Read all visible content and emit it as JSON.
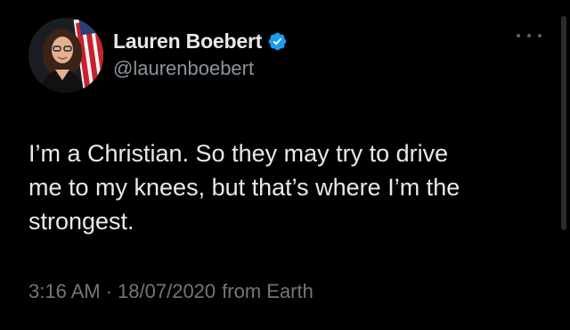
{
  "author": {
    "display_name": "Lauren Boebert",
    "handle": "@laurenboebert",
    "verified_icon": "verified-badge-icon",
    "avatar_icon": "profile-photo"
  },
  "more_menu_icon": "more-options-icon",
  "tweet": {
    "text": "I’m a Christian. So they may try to drive\nme to my knees, but that’s where I’m the\nstrongest.",
    "time": "3:16 AM",
    "separator": "·",
    "date": "18/07/2020",
    "source": "from Earth"
  },
  "colors": {
    "background": "#000000",
    "primary_text": "#e7e9ea",
    "secondary_text": "#71767b",
    "verified_blue": "#1d9bf0"
  }
}
